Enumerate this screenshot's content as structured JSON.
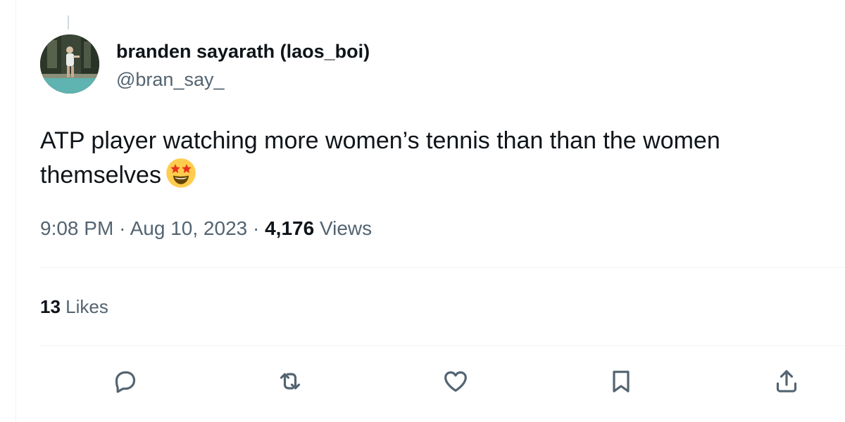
{
  "author": {
    "display_name": "branden sayarath (laos_boi)",
    "handle": "@bran_say_",
    "avatar_icon": "profile-photo"
  },
  "tweet": {
    "text": "ATP player watching more women’s tennis than than the women themselves",
    "emoji": "star-struck-emoji"
  },
  "meta": {
    "time": "9:08 PM",
    "separator": "·",
    "date": "Aug 10, 2023",
    "views_count": "4,176",
    "views_label": "Views"
  },
  "engagement": {
    "likes_count": "13",
    "likes_label": "Likes"
  },
  "actions": [
    {
      "name": "reply",
      "icon": "reply-icon"
    },
    {
      "name": "retweet",
      "icon": "retweet-icon"
    },
    {
      "name": "like",
      "icon": "heart-icon"
    },
    {
      "name": "bookmark",
      "icon": "bookmark-icon"
    },
    {
      "name": "share",
      "icon": "share-icon"
    }
  ],
  "colors": {
    "text_primary": "#0f1419",
    "text_secondary": "#536471",
    "divider": "#eff3f4",
    "emoji_face": "#ffcc4d",
    "emoji_star": "#f4900c"
  }
}
